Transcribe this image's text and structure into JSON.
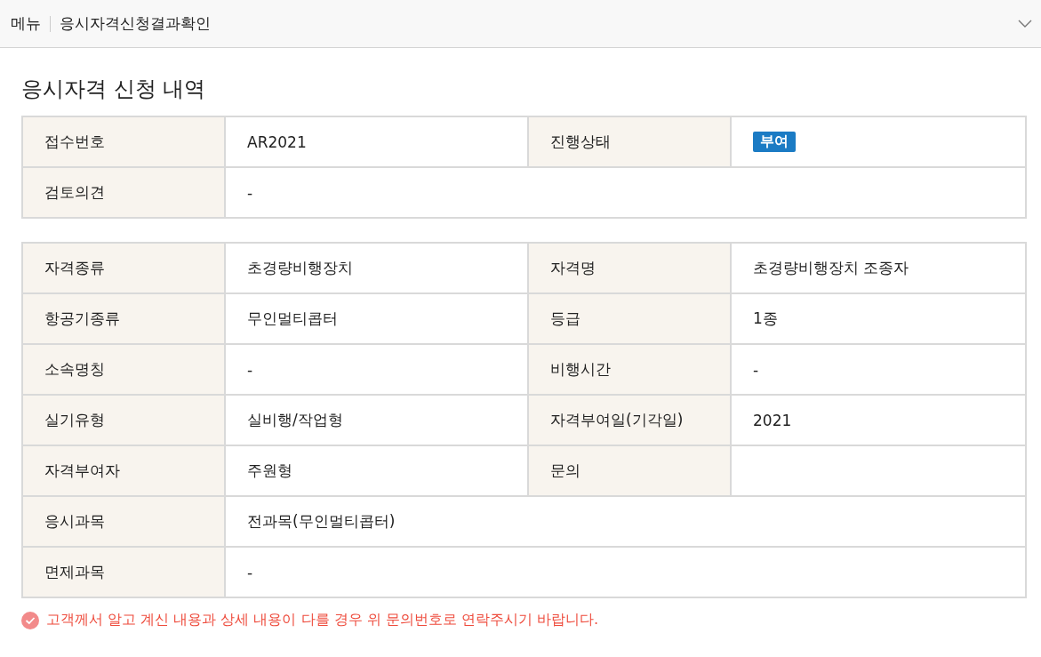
{
  "header": {
    "menu_label": "메뉴",
    "page_title": "응시자격신청결과확인"
  },
  "title": "응시자격 신청 내역",
  "status_table": {
    "rows": [
      {
        "cells": [
          {
            "label": "접수번호",
            "value": "AR2021",
            "kind": "text"
          },
          {
            "label": "진행상태",
            "value": "부여",
            "kind": "badge"
          }
        ]
      },
      {
        "cells": [
          {
            "label": "검토의견",
            "value": "-",
            "kind": "text"
          }
        ]
      }
    ]
  },
  "detail_table": {
    "rows": [
      {
        "cells": [
          {
            "label": "자격종류",
            "value": "초경량비행장치",
            "kind": "text"
          },
          {
            "label": "자격명",
            "value": "초경량비행장치 조종자",
            "kind": "text"
          }
        ]
      },
      {
        "cells": [
          {
            "label": "항공기종류",
            "value": "무인멀티콥터",
            "kind": "text"
          },
          {
            "label": "등급",
            "value": "1종",
            "kind": "text"
          }
        ]
      },
      {
        "cells": [
          {
            "label": "소속명칭",
            "value": "-",
            "kind": "text"
          },
          {
            "label": "비행시간",
            "value": "-",
            "kind": "text"
          }
        ]
      },
      {
        "cells": [
          {
            "label": "실기유형",
            "value": "실비행/작업형",
            "kind": "text"
          },
          {
            "label": "자격부여일(기각일)",
            "value": "2021",
            "kind": "text"
          }
        ]
      },
      {
        "cells": [
          {
            "label": "자격부여자",
            "value": "주원형",
            "kind": "text"
          },
          {
            "label": "문의",
            "kind": "text"
          }
        ]
      },
      {
        "cells": [
          {
            "label": "응시과목",
            "value": "전과목(무인멀티콥터)",
            "kind": "text"
          }
        ]
      },
      {
        "cells": [
          {
            "label": "면제과목",
            "value": "-",
            "kind": "text"
          }
        ]
      }
    ]
  },
  "notice": "고객께서 알고 계신 내용과 상세 내용이 다를 경우 위 문의번호로 연락주시기 바랍니다."
}
